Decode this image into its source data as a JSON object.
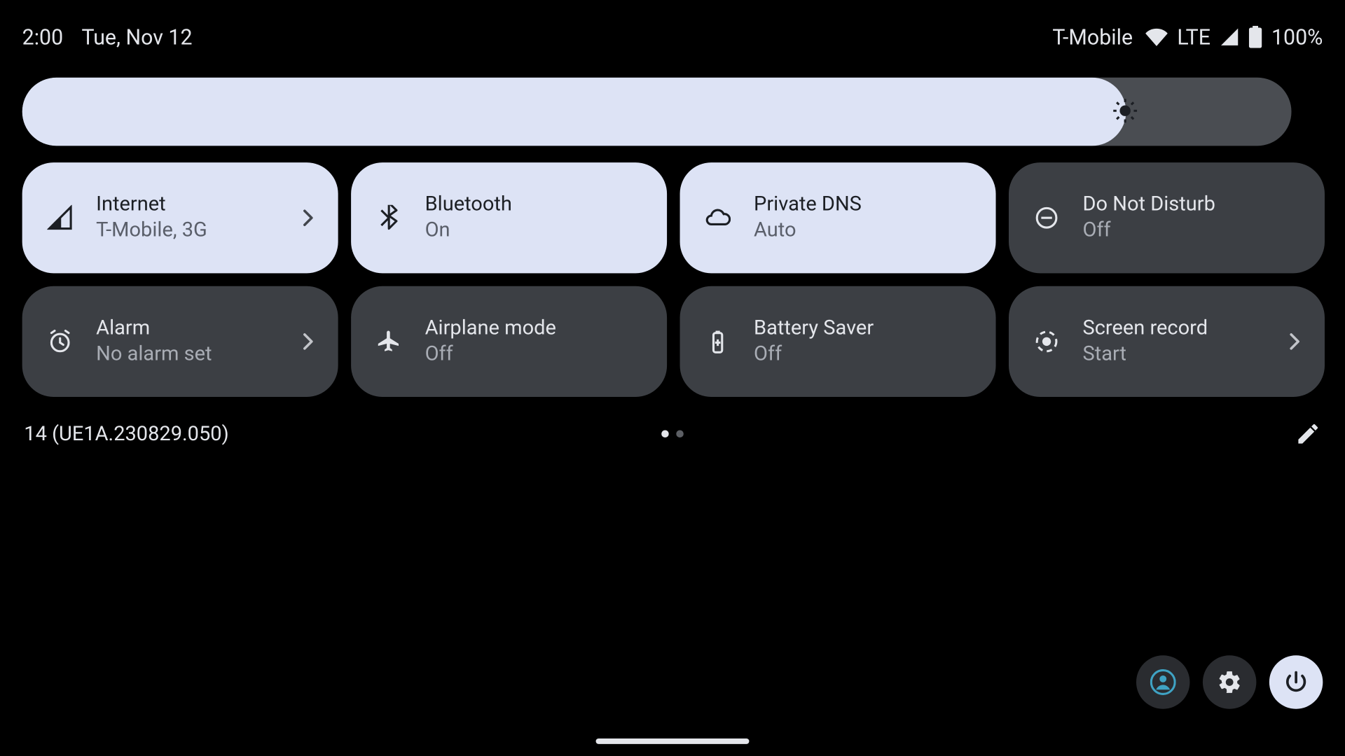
{
  "status": {
    "time": "2:00",
    "date": "Tue, Nov 12",
    "carrier": "T-Mobile",
    "network": "LTE",
    "battery": "100%"
  },
  "brightness": {
    "percent": 87
  },
  "tiles": [
    {
      "icon": "signal",
      "title": "Internet",
      "sub": "T-Mobile, 3G",
      "active": true,
      "chevron": true
    },
    {
      "icon": "bluetooth",
      "title": "Bluetooth",
      "sub": "On",
      "active": true,
      "chevron": false
    },
    {
      "icon": "cloud",
      "title": "Private DNS",
      "sub": "Auto",
      "active": true,
      "chevron": false
    },
    {
      "icon": "dnd",
      "title": "Do Not Disturb",
      "sub": "Off",
      "active": false,
      "chevron": false
    },
    {
      "icon": "alarm",
      "title": "Alarm",
      "sub": "No alarm set",
      "active": false,
      "chevron": true
    },
    {
      "icon": "airplane",
      "title": "Airplane mode",
      "sub": "Off",
      "active": false,
      "chevron": false
    },
    {
      "icon": "battery",
      "title": "Battery Saver",
      "sub": "Off",
      "active": false,
      "chevron": false
    },
    {
      "icon": "record",
      "title": "Screen record",
      "sub": "Start",
      "active": false,
      "chevron": true
    }
  ],
  "page_indicator": {
    "count": 2,
    "active": 0
  },
  "build": "14 (UE1A.230829.050)"
}
